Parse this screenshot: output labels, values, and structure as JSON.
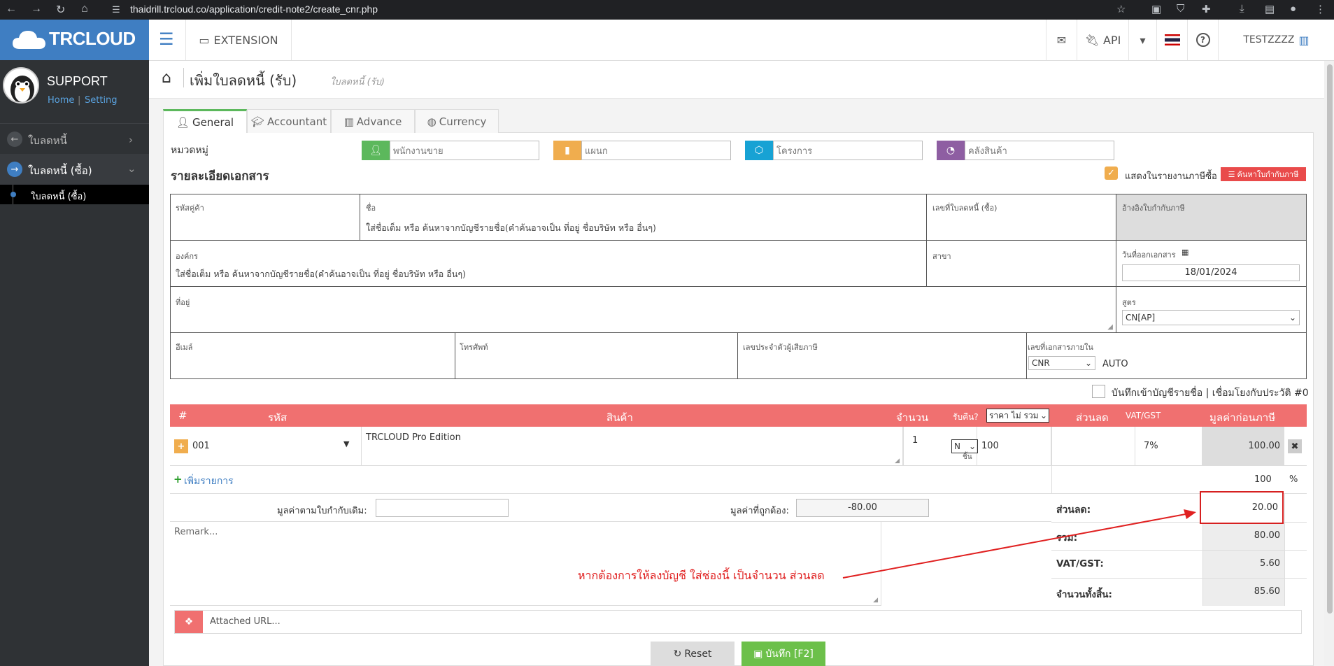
{
  "browser": {
    "url": "thaidrill.trcloud.co/application/credit-note2/create_cnr.php"
  },
  "app": {
    "logo_text": "TRCLOUD",
    "user_name": "SUPPORT",
    "home_link": "Home",
    "setting_link": "Setting"
  },
  "sidebar": {
    "items": [
      {
        "label": "ใบลดหนี้"
      },
      {
        "label": "ใบลดหนี้ (ซื้อ)"
      },
      {
        "label": "ใบลดหนี้ (ซื้อ)"
      }
    ]
  },
  "topbar": {
    "extension_label": "EXTENSION",
    "api_label": "API",
    "company_label": "TESTZZZZ"
  },
  "page": {
    "title": "เพิ่มใบลดหนี้ (รับ)",
    "subtitle": "ใบลดหนี้ (รับ)"
  },
  "tabs": [
    {
      "label": "General"
    },
    {
      "label": "Accountant"
    },
    {
      "label": "Advance"
    },
    {
      "label": "Currency"
    }
  ],
  "category": {
    "label": "หมวดหมู่",
    "salesperson_ph": "พนักงานขาย",
    "department_ph": "แผนก",
    "project_ph": "โครงการ",
    "warehouse_ph": "คลังสินค้า"
  },
  "details": {
    "heading": "รายละเอียดเอกสาร",
    "show_in_tax_report": "แสดงในรายงานภาษีซื้อ",
    "find_tax_invoice": "ค้นหาใบกำกับภาษี",
    "customer_code_label": "รหัสคู่ค้า",
    "name_label": "ชื่อ",
    "name_ph": "ใส่ชื่อเต็ม หรือ ค้นหาจากบัญชีรายชื่อ(คำค้นอาจเป็น ที่อยู่ ชื่อบริษัท หรือ อื่นๆ)",
    "credit_note_no_label": "เลขที่ใบลดหนี้ (ซื้อ)",
    "ref_tax_invoice_label": "อ้างอิงใบกำกับภาษี",
    "org_label": "องค์กร",
    "org_ph": "ใส่ชื่อเต็ม หรือ ค้นหาจากบัญชีรายชื่อ(คำค้นอาจเป็น ที่อยู่ ชื่อบริษัท หรือ อื่นๆ)",
    "branch_label": "สาขา",
    "issue_date_label": "วันที่ออกเอกสาร",
    "issue_date": "18/01/2024",
    "address_label": "ที่อยู่",
    "formula_label": "สูตร",
    "formula_value": "CN[AP]",
    "email_label": "อีเมล์",
    "phone_label": "โทรศัพท์",
    "tax_id_label": "เลขประจำตัวผู้เสียภาษี",
    "internal_doc_label": "เลขที่เอกสารภายใน",
    "internal_doc_value": "CNR",
    "auto_label": "AUTO",
    "save_contact_label": "บันทึกเข้าบัญชีรายชื่อ | เชื่อมโยงกับประวัติ #0"
  },
  "items_table": {
    "headers": {
      "num": "#",
      "code": "รหัส",
      "product": "สินค้า",
      "qty": "จำนวน",
      "return": "รับคืน?",
      "price_type": "ราคา ไม่ รวม",
      "discount": "ส่วนลด",
      "vat": "VAT/GST",
      "pre_tax": "มูลค่าก่อนภาษี"
    },
    "rows": [
      {
        "code": "001",
        "product": "TRCLOUD Pro Edition",
        "qty": "1",
        "unit": "ชิ้น",
        "return": "N",
        "price": "100",
        "discount": "",
        "vat": "7%",
        "pre_tax": "100.00"
      }
    ],
    "add_item": "เพิ่มรายการ",
    "percent_value": "100",
    "percent_sign": "%"
  },
  "totals": {
    "original_value_label": "มูลค่าตามใบกำกับเดิม:",
    "correct_value_label": "มูลค่าที่ถูกต้อง:",
    "correct_value": "-80.00",
    "remark_ph": "Remark...",
    "discount_label": "ส่วนลด:",
    "discount_value": "20.00",
    "total_label": "รวม:",
    "total_value": "80.00",
    "vat_label": "VAT/GST:",
    "vat_value": "5.60",
    "grand_label": "จำนวนทั้งสิ้น:",
    "grand_value": "85.60"
  },
  "annotation": {
    "text": "หากต้องการให้ลงบัญชี  ใส่ช่องนี้ เป็นจำนวน ส่วนลด",
    "color": "#e02020"
  },
  "attach": {
    "url_ph": "Attached URL..."
  },
  "actions": {
    "reset": "Reset",
    "save": "บันทึก [F2]"
  }
}
